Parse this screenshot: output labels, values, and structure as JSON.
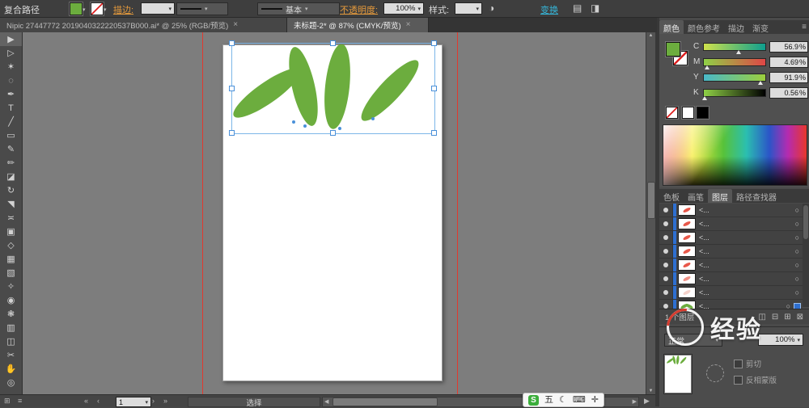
{
  "app": {
    "accent_green": "#6CAD3E",
    "leaf_red": "#E8584A",
    "selection_blue": "#4A90D9",
    "guide_red": "#E03A2F"
  },
  "ui": {
    "close": "×",
    "caret": "▾",
    "menu": "≡",
    "left": "◀",
    "right": "▶",
    "up": "▲",
    "down": "▼",
    "first": "«",
    "prev": "‹",
    "next": "›",
    "last": "»",
    "circle": "○",
    "grid": "⊞"
  },
  "control_bar": {
    "selection_type": "复合路径",
    "stroke_label": "描边:",
    "brush_name": "基本",
    "opacity_label": "不透明度:",
    "opacity_value": "100%",
    "style_label": "样式:",
    "transform_label": "变换",
    "icons": [
      {
        "name": "recolor-artwork-icon",
        "glyph": "◑"
      },
      {
        "name": "align-panel-icon",
        "glyph": "▤"
      },
      {
        "name": "document-setup-icon",
        "glyph": "◨"
      }
    ]
  },
  "tabs": [
    {
      "title": "Nipic 27447772 2019040322220537B000.ai* @ 25% (RGB/预览)"
    },
    {
      "title": "未标题-2* @ 87% (CMYK/预览)"
    }
  ],
  "tools": [
    {
      "name": "selection-tool",
      "glyph": "▶"
    },
    {
      "name": "direct-selection-tool",
      "glyph": "▷"
    },
    {
      "name": "magic-wand-tool",
      "glyph": "✶"
    },
    {
      "name": "lasso-tool",
      "glyph": "◌"
    },
    {
      "name": "pen-tool",
      "glyph": "✒"
    },
    {
      "name": "type-tool",
      "glyph": "T"
    },
    {
      "name": "line-segment-tool",
      "glyph": "╱"
    },
    {
      "name": "rectangle-tool",
      "glyph": "▭"
    },
    {
      "name": "paintbrush-tool",
      "glyph": "✎"
    },
    {
      "name": "pencil-tool",
      "glyph": "✏"
    },
    {
      "name": "eraser-tool",
      "glyph": "◪"
    },
    {
      "name": "rotate-tool",
      "glyph": "↻"
    },
    {
      "name": "scale-tool",
      "glyph": "◥"
    },
    {
      "name": "width-tool",
      "glyph": "≍"
    },
    {
      "name": "free-transform-tool",
      "glyph": "▣"
    },
    {
      "name": "shape-builder-tool",
      "glyph": "◇"
    },
    {
      "name": "mesh-tool",
      "glyph": "▦"
    },
    {
      "name": "gradient-tool",
      "glyph": "▧"
    },
    {
      "name": "eyedropper-tool",
      "glyph": "✧"
    },
    {
      "name": "blend-tool",
      "glyph": "◉"
    },
    {
      "name": "symbol-sprayer-tool",
      "glyph": "❃"
    },
    {
      "name": "column-graph-tool",
      "glyph": "▥"
    },
    {
      "name": "artboard-tool",
      "glyph": "◫"
    },
    {
      "name": "slice-tool",
      "glyph": "✂"
    },
    {
      "name": "hand-tool",
      "glyph": "✋"
    },
    {
      "name": "zoom-tool",
      "glyph": "◎"
    }
  ],
  "color_panel": {
    "tabs": [
      "颜色",
      "颜色参考",
      "描边",
      "渐变"
    ],
    "sliders": [
      {
        "label": "C",
        "value": "56.9"
      },
      {
        "label": "M",
        "value": "4.69"
      },
      {
        "label": "Y",
        "value": "91.9"
      },
      {
        "label": "K",
        "value": "0.56"
      }
    ],
    "unit": "%"
  },
  "dock_tabs": [
    "色板",
    "画笔",
    "图层",
    "路径查找器"
  ],
  "layers_panel": {
    "rows": [
      {
        "name": "<..."
      },
      {
        "name": "<..."
      },
      {
        "name": "<..."
      },
      {
        "name": "<..."
      },
      {
        "name": "<..."
      },
      {
        "name": "<..."
      },
      {
        "name": "<..."
      },
      {
        "name": "<..."
      }
    ],
    "footer": "1 个图层",
    "footer_icons": [
      {
        "name": "make-clip-mask-icon",
        "glyph": "◫"
      },
      {
        "name": "new-sublayer-icon",
        "glyph": "⊟"
      },
      {
        "name": "new-layer-icon",
        "glyph": "⊞"
      },
      {
        "name": "delete-layer-icon",
        "glyph": "⊠"
      }
    ]
  },
  "transparency_panel": {
    "blend_mode": "正常",
    "opacity_value": "100%",
    "clip_label": "剪切",
    "invert_label": "反相蒙版"
  },
  "status_bar": {
    "artboard_number": "1",
    "tool_status": "选择"
  },
  "ime_bar": {
    "items": [
      {
        "name": "ime-mode-label",
        "glyph": "五"
      },
      {
        "name": "moon-icon",
        "glyph": "☾"
      },
      {
        "name": "keyboard-icon",
        "glyph": "⌨"
      },
      {
        "name": "toolbox-icon",
        "glyph": "✛"
      }
    ],
    "logo": "S"
  },
  "watermark": {
    "text": "经验"
  }
}
